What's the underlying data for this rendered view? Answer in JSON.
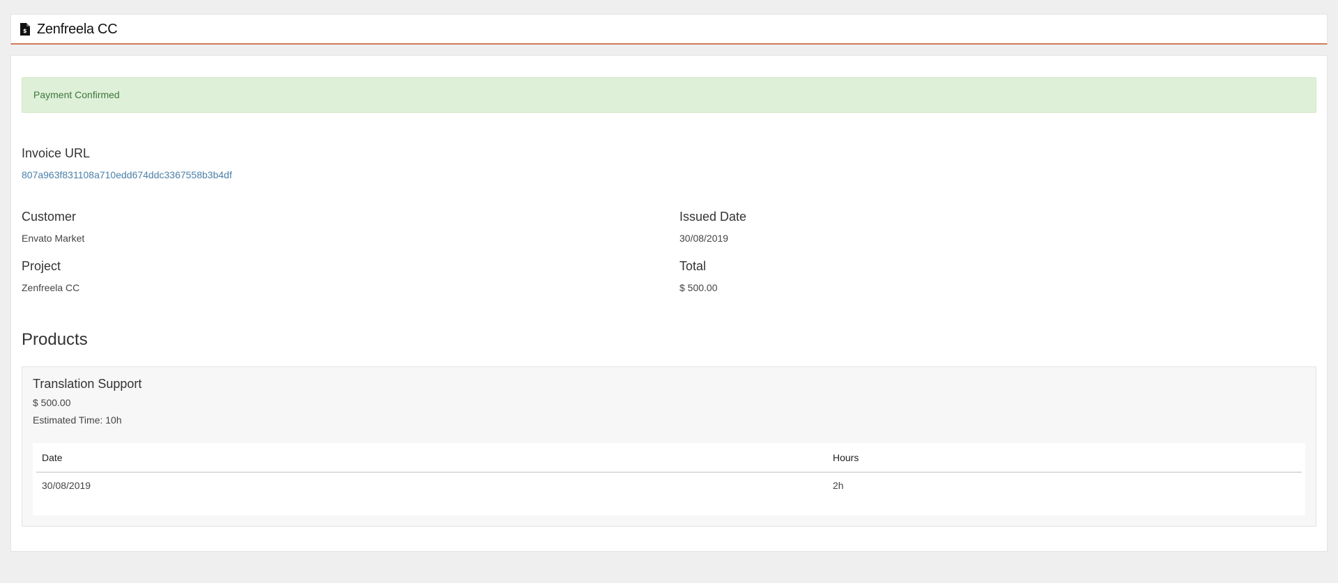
{
  "header": {
    "icon": "invoice-document-icon",
    "title": "Zenfreela CC"
  },
  "alert": {
    "text": "Payment Confirmed",
    "color": "#dff0d8"
  },
  "invoice": {
    "url_label": "Invoice URL",
    "url_value": "807a963f831108a710edd674ddc3367558b3b4df",
    "customer_label": "Customer",
    "customer_value": "Envato Market",
    "issued_label": "Issued Date",
    "issued_value": "30/08/2019",
    "project_label": "Project",
    "project_value": "Zenfreela CC",
    "total_label": "Total",
    "total_value": "$ 500.00"
  },
  "products": {
    "title": "Products",
    "items": [
      {
        "name": "Translation Support",
        "price": "$ 500.00",
        "estimated_time": "Estimated Time: 10h",
        "table": {
          "headers": [
            "Date",
            "Hours"
          ],
          "rows": [
            [
              "30/08/2019",
              "2h"
            ]
          ]
        }
      }
    ]
  },
  "colors": {
    "accent_border": "#d27a58",
    "link": "#4a7fa8",
    "background": "#efefef"
  }
}
